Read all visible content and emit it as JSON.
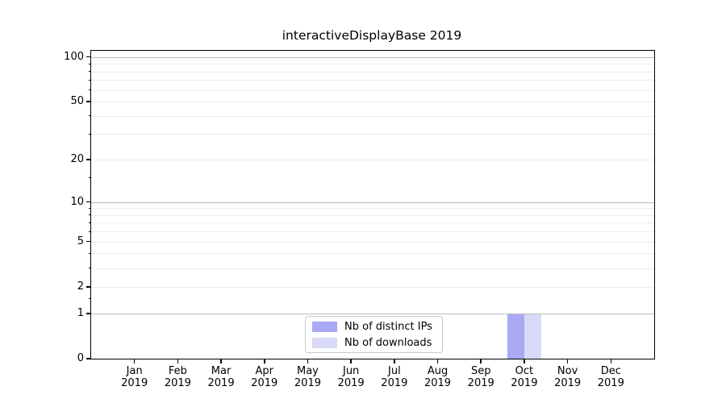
{
  "chart_data": {
    "type": "bar",
    "title": "interactiveDisplayBase 2019",
    "x_categories": [
      "Jan",
      "Feb",
      "Mar",
      "Apr",
      "May",
      "Jun",
      "Jul",
      "Aug",
      "Sep",
      "Oct",
      "Nov",
      "Dec"
    ],
    "x_year": "2019",
    "series": [
      {
        "name": "Nb of distinct IPs",
        "color": "#a9a9f5",
        "values": [
          0,
          0,
          0,
          0,
          0,
          0,
          0,
          0,
          0,
          1,
          0,
          0
        ]
      },
      {
        "name": "Nb of downloads",
        "color": "#d9d9f8",
        "values": [
          0,
          0,
          0,
          0,
          0,
          0,
          0,
          0,
          0,
          1,
          0,
          0
        ]
      }
    ],
    "y_scale": "log1p",
    "y_axis": {
      "tick_values": [
        0,
        1,
        2,
        5,
        10,
        20,
        50,
        100
      ],
      "minor_tick_values": [
        1.5,
        3,
        4,
        6,
        7,
        8,
        9,
        15,
        30,
        40,
        60,
        70,
        80,
        90
      ],
      "major_gridlines": [
        1,
        10,
        100
      ],
      "minor_gridlines": [
        2,
        3,
        4,
        5,
        6,
        7,
        8,
        9,
        20,
        30,
        40,
        50,
        60,
        70,
        80,
        90
      ],
      "ylim": [
        0,
        110
      ]
    },
    "grid": "horizontal",
    "legend_position": "lower center",
    "colors": {
      "spine": "#000000",
      "major_grid": "#bdbdbd",
      "minor_grid": "#ebebeb",
      "background": "#ffffff"
    }
  }
}
